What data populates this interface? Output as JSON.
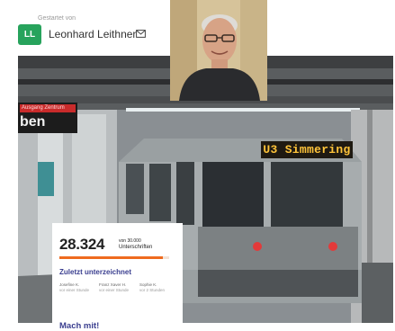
{
  "starter": {
    "label": "Gestartet von",
    "avatar_initials": "LL",
    "name": "Leonhard Leithner",
    "avatar_color": "#27a35c"
  },
  "scene": {
    "destination": "U3 Simmering",
    "station_sign_name": "ben",
    "station_sign_top": "Ausgang Zentrum"
  },
  "petition": {
    "count": "28.324",
    "count_sub1": "von 30.000",
    "count_sub2": "Unterschriften",
    "progress_fraction": 0.944,
    "progress_color": "#ef6b1f",
    "recent_heading": "Zuletzt unterzeichnet",
    "signers": [
      {
        "name": "Josefine K.",
        "time": "vor einer Stunde"
      },
      {
        "name": "Franz Xaver H.",
        "time": "vor einer Stunde"
      },
      {
        "name": "Sophie K.",
        "time": "vor 2 Stunden"
      }
    ],
    "cta": "Mach mit!"
  },
  "icons": {
    "mail": "mail-icon",
    "video": "webcam-video"
  }
}
